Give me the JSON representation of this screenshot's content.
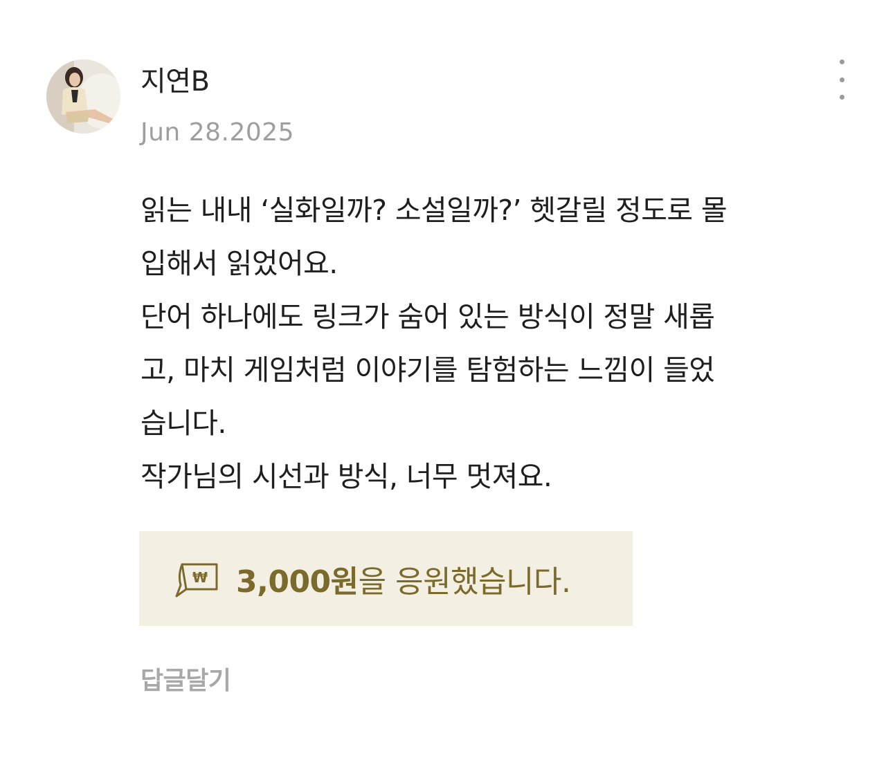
{
  "comment": {
    "author": "지연B",
    "date": "Jun 28.2025",
    "body_lines": [
      "읽는 내내 ‘실화일까? 소설일까?’ 헷갈릴 정도로 몰",
      "입해서 읽었어요.",
      "단어 하나에도 링크가 숨어 있는 방식이 정말 새롭",
      "고, 마치 게임처럼 이야기를 탐험하는 느낌이 들었",
      "습니다.",
      "작가님의 시선과 방식, 너무 멋져요."
    ],
    "more_icon": "more-vertical-icon",
    "support": {
      "icon": "won-banknote-icon",
      "amount": "3,000원",
      "suffix": "을 응원했습니다.",
      "text_color": "#7a6a2c",
      "background": "#f3efe3"
    },
    "reply_label": "답글달기"
  }
}
